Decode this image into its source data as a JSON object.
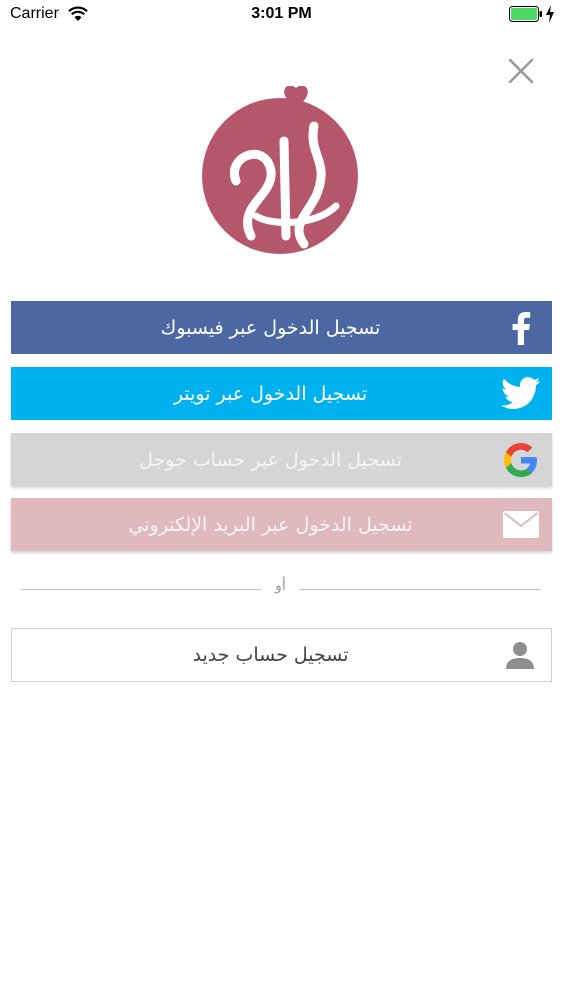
{
  "status_bar": {
    "carrier": "Carrier",
    "time": "3:01 PM",
    "battery_color": "#4cd964"
  },
  "close": {
    "icon": "close-icon"
  },
  "logo": {
    "color": "#b5576b"
  },
  "login_options": {
    "facebook": {
      "label": "تسجيل الدخول عبر فيسبوك",
      "color": "#4b68a3",
      "icon": "facebook-icon"
    },
    "twitter": {
      "label": "تسجيل الدخول عبر تويتر",
      "color": "#00b1ef",
      "icon": "twitter-icon"
    },
    "google": {
      "label": "تسجيل الدخول عبر حساب جوجل",
      "color": "#d5d5d7",
      "icon": "google-icon"
    },
    "email": {
      "label": "تسجيل الدخول عبر البريد الإلكتروني",
      "color": "#dfb9bd",
      "icon": "mail-icon"
    }
  },
  "divider": {
    "text": "أو"
  },
  "register": {
    "label": "تسجيل حساب جديد",
    "icon": "user-icon"
  }
}
